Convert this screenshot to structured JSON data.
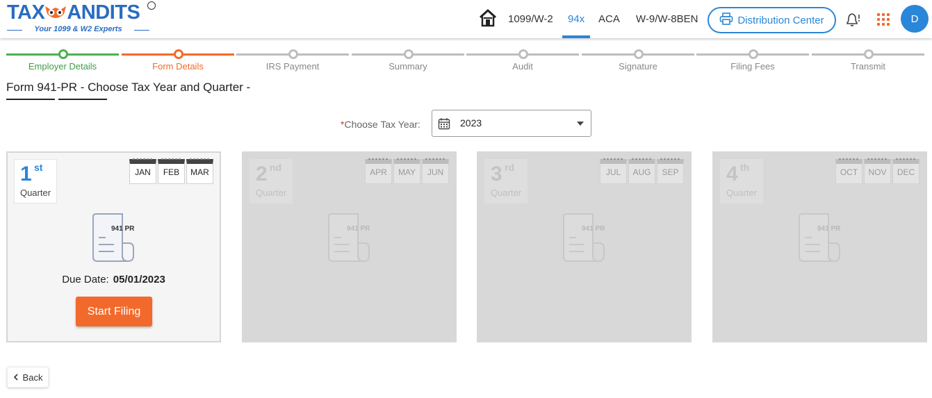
{
  "header": {
    "logo_text": "TAXBANDITS",
    "logo_tm": "TM",
    "logo_tagline": "Your 1099 & W2 Experts",
    "nav": [
      {
        "label": "1099/W-2"
      },
      {
        "label": "94x"
      },
      {
        "label": "ACA"
      },
      {
        "label": "W-9/W-8BEN"
      }
    ],
    "distribution_center": "Distribution Center",
    "avatar_initial": "D",
    "accent_color": "#2a86d8",
    "brand_orange": "#f26a2b"
  },
  "stepper": {
    "steps": [
      {
        "label": "Employer Details",
        "state": "done"
      },
      {
        "label": "Form Details",
        "state": "current"
      },
      {
        "label": "IRS Payment",
        "state": "pending"
      },
      {
        "label": "Summary",
        "state": "pending"
      },
      {
        "label": "Audit",
        "state": "pending"
      },
      {
        "label": "Signature",
        "state": "pending"
      },
      {
        "label": "Filing Fees",
        "state": "pending"
      },
      {
        "label": "Transmit",
        "state": "pending"
      }
    ]
  },
  "page": {
    "title": "Form 941-PR - Choose Tax Year and Quarter -",
    "tax_year_required_mark": "*",
    "tax_year_label": "Choose Tax Year:",
    "tax_year_value": "2023"
  },
  "quarters": [
    {
      "num": "1",
      "sup": "st",
      "word": "Quarter",
      "months": [
        "JAN",
        "FEB",
        "MAR"
      ],
      "doc_label": "941 PR",
      "due_label": "Due Date:",
      "due_value": "05/01/2023",
      "button": "Start Filing",
      "enabled": true
    },
    {
      "num": "2",
      "sup": "nd",
      "word": "Quarter",
      "months": [
        "APR",
        "MAY",
        "JUN"
      ],
      "doc_label": "941 PR",
      "enabled": false
    },
    {
      "num": "3",
      "sup": "rd",
      "word": "Quarter",
      "months": [
        "JUL",
        "AUG",
        "SEP"
      ],
      "doc_label": "941 PR",
      "enabled": false
    },
    {
      "num": "4",
      "sup": "th",
      "word": "Quarter",
      "months": [
        "OCT",
        "NOV",
        "DEC"
      ],
      "doc_label": "941 PR",
      "enabled": false
    }
  ],
  "footer": {
    "back_label": "Back"
  }
}
